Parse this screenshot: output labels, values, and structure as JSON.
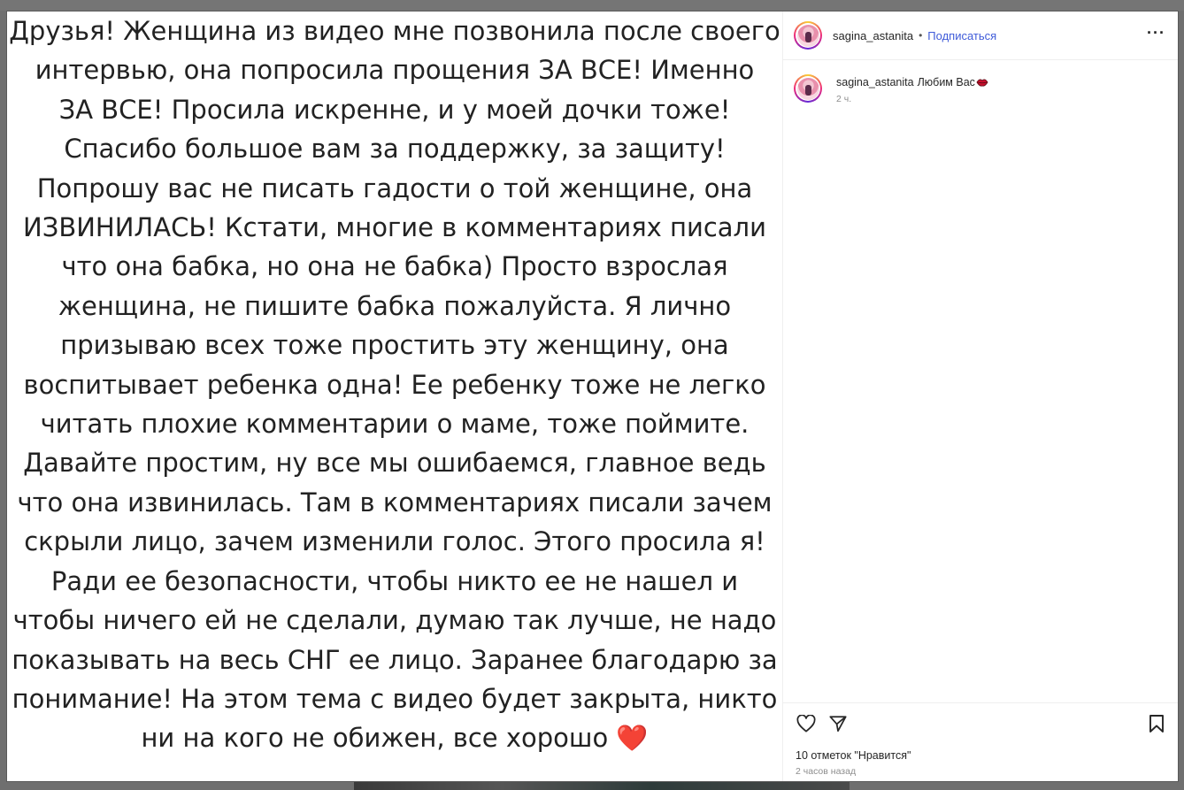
{
  "post": {
    "caption_lines": [
      "Друзья! Женщина из видео мне позвонила после своего",
      "интервью, она попросила прощения ЗА ВСЕ! Именно",
      "ЗА ВСЕ! Просила искренне, и у моей дочки тоже!",
      "Спасибо большое вам за поддержку, за защиту!",
      "Попрошу вас не писать гадости о той женщине, она",
      "ИЗВИНИЛАСЬ! Кстати, многие в комментариях писали",
      "что она бабка, но она не бабка) Просто взрослая",
      "женщина, не пишите бабка пожалуйста. Я лично",
      "призываю всех тоже простить эту женщину, она",
      "воспитывает ребенка одна! Ее ребенку тоже не легко",
      "читать плохие комментарии о маме, тоже поймите.",
      "Давайте простим, ну все мы ошибаемся, главное ведь",
      "что она извинилась. Там в комментариях писали зачем",
      "скрыли лицо, зачем изменили голос. Этого просила я!",
      "Ради ее безопасности, чтобы никто ее не нашел и",
      "чтобы ничего ей не сделали, думаю так лучше, не надо",
      "показывать на весь СНГ ее лицо. Заранее благодарю за",
      "понимание! На этом тема с видео будет закрыта, никто",
      "ни на кого не обижен, все хорошо"
    ],
    "heart_emoji": "❤️"
  },
  "header": {
    "username": "sagina_astanita",
    "separator": "•",
    "follow_label": "Подписаться",
    "more_icon": "more-icon",
    "more_label": "···"
  },
  "comment": {
    "username": "sagina_astanita",
    "text": "Любим Вас",
    "emoji_icon": "lips-icon",
    "time": "2 ч."
  },
  "actions": {
    "likes_text": "10 отметок \"Нравится\"",
    "posted_time": "2 часов назад",
    "like_icon": "heart-icon",
    "share_icon": "send-icon",
    "save_icon": "bookmark-icon"
  },
  "colors": {
    "follow_blue": "#3f5bd9",
    "heart_red": "#e0262d",
    "muted_gray": "#8e8e8e"
  }
}
